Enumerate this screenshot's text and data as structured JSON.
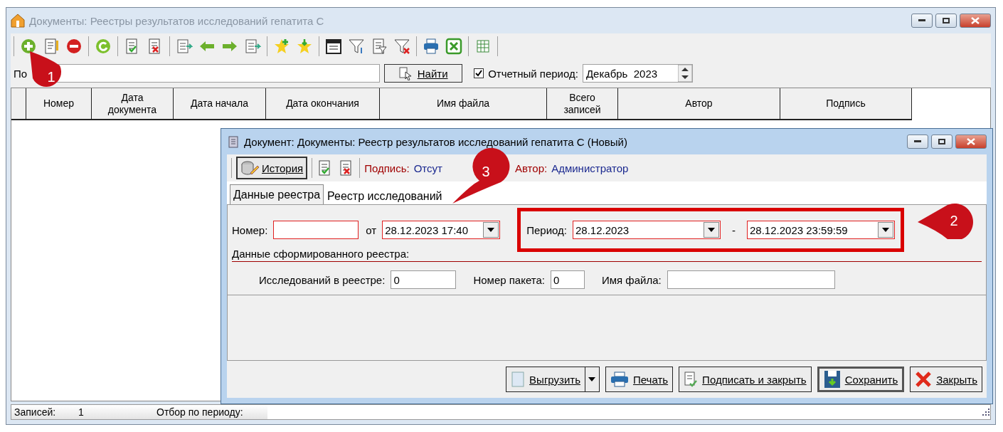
{
  "window": {
    "title": "Документы: Реестры результатов исследований гепатита С"
  },
  "search": {
    "label": "По",
    "button": "Найти",
    "period_checkbox": {
      "label": "Отчетный период:",
      "checked": true
    },
    "period_value": "Декабрь  2023"
  },
  "table": {
    "columns": [
      "Номер",
      "Дата документа",
      "Дата начала",
      "Дата окончания",
      "Имя файла",
      "Всего записей",
      "Автор",
      "Подпись"
    ]
  },
  "status_bar": {
    "records_label": "Записей:",
    "records_value": "1",
    "filter_label": "Отбор по периоду:"
  },
  "dialog": {
    "title": "Документ: Документы: Реестр результатов исследований гепатита С (Новый)",
    "toolbar": {
      "history_button": "История",
      "signature_label": "Подпись:",
      "signature_value": "Отсут",
      "author_label": "Автор:",
      "author_value": "Администратор"
    },
    "tabs": [
      {
        "label": "Данные реестра",
        "selected": true
      },
      {
        "label": "Реестр исследований",
        "selected": false
      }
    ],
    "number_label": "Номер:",
    "date_label": "от",
    "date_value": "28.12.2023 17:40",
    "period_label": "Период:",
    "period_from": "28.12.2023",
    "period_dash": "-",
    "period_to": "28.12.2023 23:59:59",
    "section_title": "Данные сформированного реестра:",
    "fields": [
      {
        "label": "Исследований в реестре:",
        "value": "0"
      },
      {
        "label": "Номер пакета:",
        "value": "0"
      },
      {
        "label": "Имя файла:"
      }
    ],
    "buttons": [
      {
        "kind": "export",
        "label": "Выгрузить"
      },
      {
        "kind": "print",
        "label": "Печать"
      },
      {
        "kind": "sign",
        "label": "Подписать и закрыть"
      },
      {
        "kind": "save",
        "label": "Сохранить"
      },
      {
        "kind": "close",
        "label": "Закрыть"
      }
    ]
  },
  "callouts": [
    {
      "number": "1"
    },
    {
      "number": "2"
    },
    {
      "number": "3"
    }
  ]
}
